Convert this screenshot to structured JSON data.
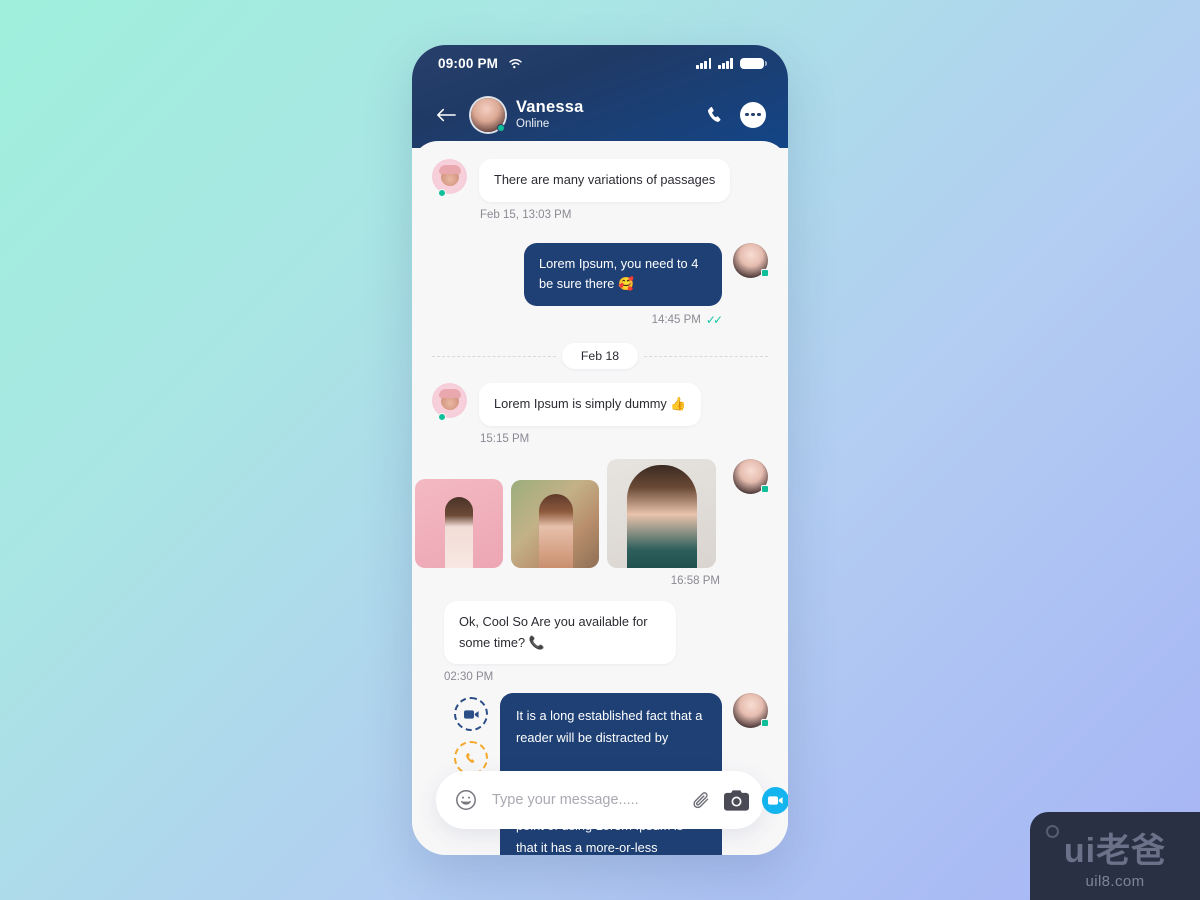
{
  "statusbar": {
    "time": "09:00 PM",
    "wifi_icon": "wifi-icon",
    "signal_icon_1": "signal-bars-icon",
    "signal_icon_2": "signal-bars-icon",
    "battery_icon": "battery-icon"
  },
  "header": {
    "back_icon": "back-arrow-icon",
    "avatar": "contact-avatar",
    "name": "Vanessa",
    "status": "Online",
    "call_icon": "phone-icon",
    "more_icon": "more-options-icon"
  },
  "messages": [
    {
      "id": "m1",
      "side": "in",
      "text": "There are many variations of passages",
      "time": "Feb 15, 13:03 PM"
    },
    {
      "id": "m2",
      "side": "out",
      "text": "Lorem Ipsum, you need to 4 be sure there 🥰",
      "time": "14:45 PM",
      "read_ticks": "✓✓"
    },
    {
      "id": "divider",
      "side": "divider",
      "text": "Feb 18"
    },
    {
      "id": "m3",
      "side": "in",
      "text": "Lorem Ipsum is simply dummy 👍",
      "time": "15:15 PM"
    },
    {
      "id": "m4",
      "side": "gallery",
      "time": "16:58 PM",
      "photos": [
        "photo-pink-portrait",
        "photo-outdoor-portrait",
        "photo-smiling-portrait"
      ]
    },
    {
      "id": "m5",
      "side": "in",
      "text": "Ok, Cool So Are you available for some time? 📞",
      "time": "02:30 PM"
    },
    {
      "id": "m6",
      "side": "out-calls",
      "text": "It is a long established fact that a reader will be distracted by\n\nThe readable content of a page when looking at its layout. The point of using Lorem Ipsum is that it has a more-or-less",
      "video_icon": "video-call-icon",
      "call_icon": "voice-call-icon"
    }
  ],
  "input": {
    "emoji_icon": "smiley-icon",
    "placeholder": "Type your message.....",
    "value": "",
    "attach_icon": "paperclip-icon",
    "camera_icon": "camera-icon",
    "video_icon": "video-record-icon"
  },
  "watermark": {
    "logo": "ui老爸",
    "domain": "uil8.com"
  },
  "colors": {
    "header_navy": "#27406B",
    "header_navy_end": "#134587",
    "bubble_out": "#1E4074",
    "bubble_in": "#FFFFFF",
    "chat_bg": "#F7F7F8",
    "online_dot": "#0FBF9A",
    "tick_green": "#17C5A3",
    "accent_blue": "#14B4EF",
    "ring_video": "#2B4E86",
    "ring_call": "#F4A92B",
    "bg_start": "#9FEFDC",
    "bg_end": "#A6B4F5"
  }
}
